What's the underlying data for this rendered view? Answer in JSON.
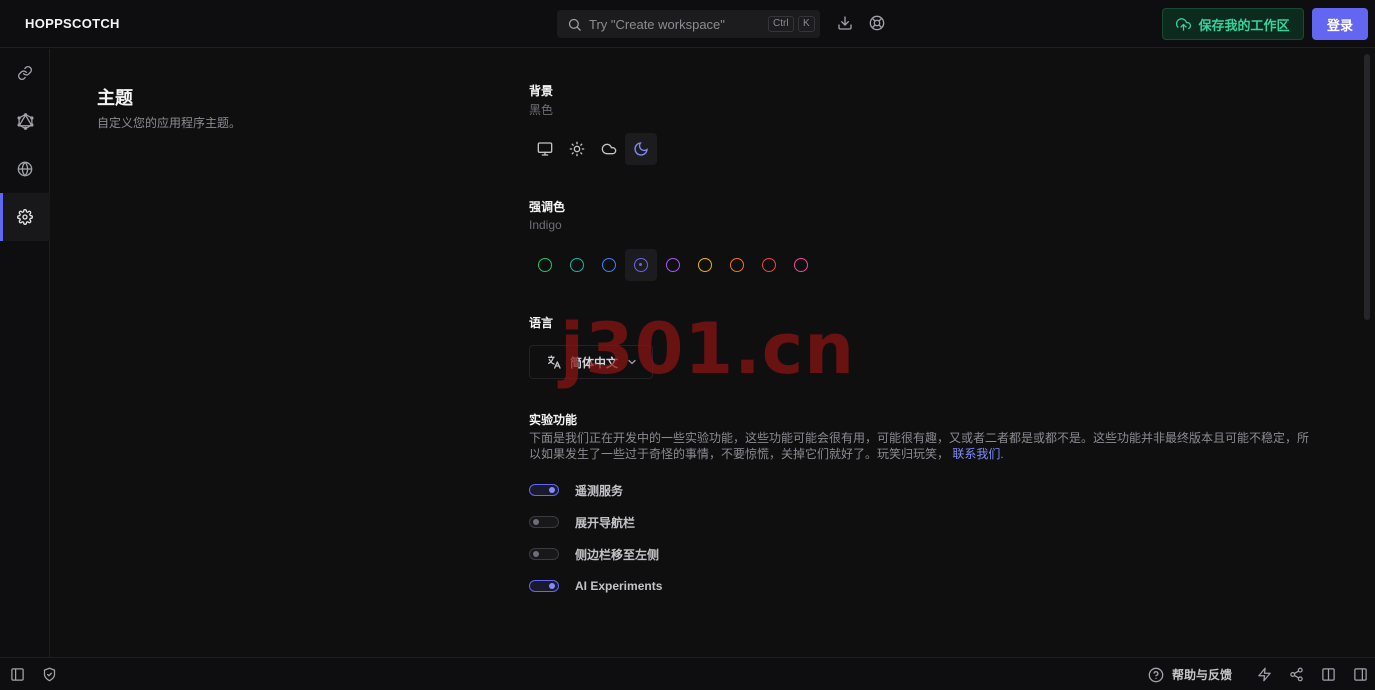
{
  "header": {
    "logo": "HOPPSCOTCH",
    "search_placeholder": "Try \"Create workspace\"",
    "kbd_ctrl": "Ctrl",
    "kbd_k": "K",
    "save_workspace": "保存我的工作区",
    "login": "登录"
  },
  "sidebar": {
    "items": [
      {
        "name": "rest",
        "icon": "link-icon"
      },
      {
        "name": "graphql",
        "icon": "graphql-icon"
      },
      {
        "name": "realtime",
        "icon": "globe-icon"
      },
      {
        "name": "settings",
        "icon": "gear-icon",
        "active": true
      }
    ]
  },
  "theme": {
    "title": "主题",
    "description": "自定义您的应用程序主题。",
    "background_label": "背景",
    "background_value": "黑色",
    "background_options": [
      "system",
      "light",
      "dark",
      "black"
    ],
    "background_selected": "black",
    "accent_label": "强调色",
    "accent_value": "Indigo",
    "accent_colors": [
      "#22c55e",
      "#14b8a6",
      "#3b82f6",
      "#6366f1",
      "#a855f7",
      "#eab308",
      "#f97316",
      "#ef4444",
      "#ec4899"
    ],
    "accent_selected_index": 3,
    "language_label": "语言",
    "language_value": "简体中文"
  },
  "experiments": {
    "label": "实验功能",
    "description": "下面是我们正在开发中的一些实验功能，这些功能可能会很有用，可能很有趣，又或者二者都是或都不是。这些功能并非最终版本且可能不稳定，所以如果发生了一些过于奇怪的事情，不要惊慌，关掉它们就好了。玩笑归玩笑，",
    "contact_link": "联系我们",
    "toggles": [
      {
        "label": "遥测服务",
        "on": true
      },
      {
        "label": "展开导航栏",
        "on": false
      },
      {
        "label": "侧边栏移至左侧",
        "on": false
      },
      {
        "label": "AI Experiments",
        "on": true
      }
    ]
  },
  "footer": {
    "help": "帮助与反馈"
  },
  "watermark": "j301.cn",
  "colors": {
    "accent": "#6366f1",
    "save_green": "#34d399",
    "background": "#0f0f10"
  }
}
